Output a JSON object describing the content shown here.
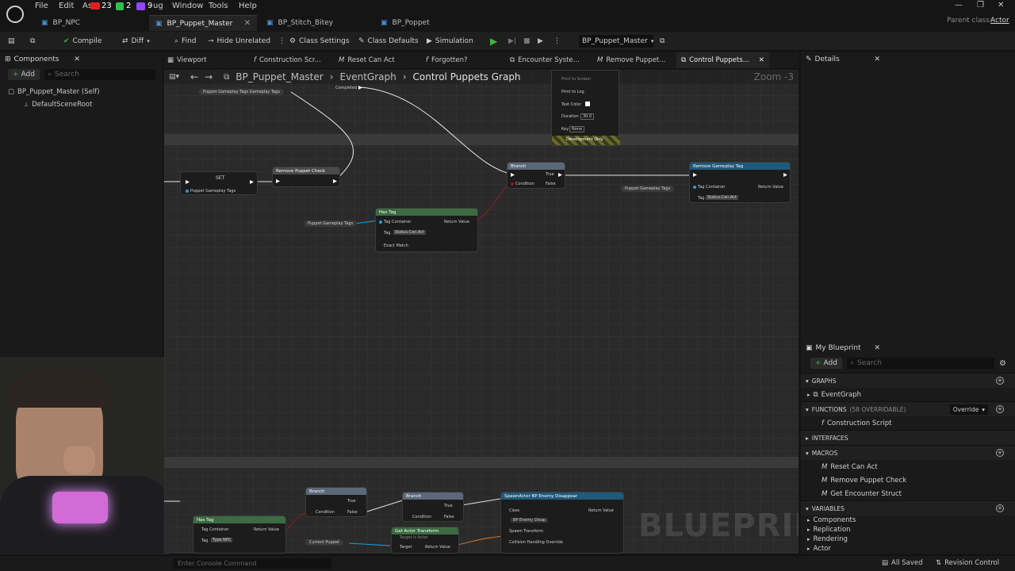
{
  "menu": {
    "file": "File",
    "edit": "Edit",
    "asset": "As",
    "window": "Window",
    "tools": "Tools",
    "help": "Help",
    "badge_red": "23",
    "badge_green": "2",
    "badge_purple": "9",
    "debug_suffix": "ug"
  },
  "tabs": [
    {
      "label": "BP_NPC"
    },
    {
      "label": "BP_Puppet_Master"
    },
    {
      "label": "BP_Stitch_Bitey"
    },
    {
      "label": "BP_Poppet"
    }
  ],
  "parent_class": {
    "label": "Parent class:",
    "value": "Actor"
  },
  "toolbar": {
    "compile": "Compile",
    "diff": "Diff",
    "find": "Find",
    "hide_unrelated": "Hide Unrelated",
    "class_settings": "Class Settings",
    "class_defaults": "Class Defaults",
    "simulation": "Simulation",
    "debug_object": "BP_Puppet_Master"
  },
  "components": {
    "title": "Components",
    "add": "Add",
    "search_placeholder": "Search",
    "root": "BP_Puppet_Master (Self)",
    "child": "DefaultSceneRoot"
  },
  "graph_tabs": [
    {
      "label": "Viewport"
    },
    {
      "label": "Construction Scr..."
    },
    {
      "label": "Reset Can Act"
    },
    {
      "label": "Forgotten?"
    },
    {
      "label": "Encounter Syste..."
    },
    {
      "label": "Remove Puppet..."
    },
    {
      "label": "Control Puppets..."
    }
  ],
  "breadcrumb": {
    "root": "BP_Puppet_Master",
    "graph": "EventGraph",
    "current": "Control Puppets Graph"
  },
  "zoom": "Zoom -3",
  "nodes": {
    "puppet_tags_top": "Puppet Gameplay Tags Gameplay Tags",
    "completed": "Completed",
    "print_to_screen": "Print to Screen",
    "print_to_log": "Print to Log",
    "text_color": "Text Color",
    "duration": "Duration",
    "duration_val": "30.0",
    "key": "Key",
    "key_val": "None",
    "dev_only": "Development Only",
    "set": "SET",
    "set_var": "Puppet Gameplay Tags",
    "remove_check": "Remove Puppet Check",
    "branch": "Branch",
    "true": "True",
    "false": "False",
    "condition": "Condition",
    "remove_tag": "Remove Gameplay Tag",
    "tag_container": "Tag Container",
    "return_value": "Return Value",
    "tag": "Tag",
    "status_can_act": "Status.Can.Act",
    "puppet_tags": "Puppet Gameplay Tags",
    "has_tag": "Has Tag",
    "exact_match": "Exact Match",
    "type_npc": "Type.NPC",
    "get_actor_transform": "Get Actor Transform",
    "target_is_actor": "Target is Actor",
    "target": "Target",
    "current_puppet": "Current Puppet",
    "spawn_actor": "SpawnActor BP Enemy Disappear",
    "class": "Class",
    "class_val": "BP Enemy Disap",
    "spawn_transform": "Spawn Transform",
    "collision": "Collision Handling Override",
    "watermark": "BLUEPRINT"
  },
  "details": {
    "title": "Details"
  },
  "my_blueprint": {
    "title": "My Blueprint",
    "add": "Add",
    "search_placeholder": "Search",
    "graphs": "GRAPHS",
    "event_graph": "EventGraph",
    "functions": "FUNCTIONS",
    "functions_count": "(58 OVERRIDABLE)",
    "override": "Override",
    "construction_script": "Construction Script",
    "interfaces": "INTERFACES",
    "macros": "MACROS",
    "macro_items": [
      "Reset Can Act",
      "Remove Puppet Check",
      "Get Encounter Struct"
    ],
    "variables": "VARIABLES",
    "variable_items": [
      "Components",
      "Replication",
      "Rendering",
      "Actor"
    ]
  },
  "status": {
    "console_placeholder": "Enter Console Command",
    "all_saved": "All Saved",
    "revision_control": "Revision Control"
  },
  "colors": {
    "accent_blue": "#1fa0d8",
    "exec_white": "#ffffff",
    "branch_header": "#5b6878",
    "function_header": "#1f5a7a",
    "pure_header": "#3d6a42",
    "play_green": "#3fb43f"
  }
}
